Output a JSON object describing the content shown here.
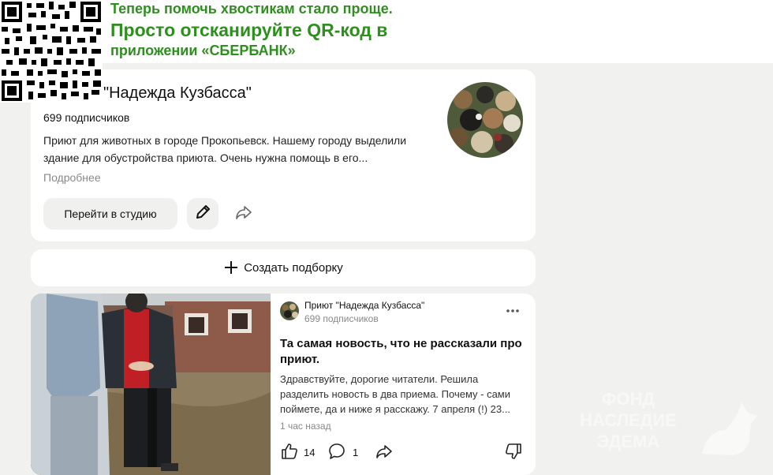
{
  "promo": {
    "line1": "Теперь помочь хвостикам стало проще.",
    "line2": "Просто отсканируйте QR-код в",
    "line3": "приложении «СБЕРБАНК»",
    "color": "#2e8f1f"
  },
  "profile": {
    "name": "\"Надежда Кузбасса\"",
    "subscribers": "699 подписчиков",
    "description": "Приют для животных в городе Прокопьевск. Нашему городу выделили здание для обустройства приюта. Очень нужна помощь в его...",
    "more_label": "Подробнее",
    "studio_button": "Перейти в студию",
    "icons": [
      "pencil-icon",
      "share-icon"
    ]
  },
  "collection": {
    "label": "Создать подборку",
    "icon": "plus-icon"
  },
  "post": {
    "channel": "Приют \"Надежда Кузбасса\"",
    "subscribers": "699 подписчиков",
    "menu_icon": "more-dots-icon",
    "title": "Та самая новость, что не рассказали про приют.",
    "text": "Здравствуйте, дорогие читатели. Решила разделить новость в два приема. Почему - сами поймете, да и ниже я расскажу. 7 апреля (!) 23...",
    "time": "1 час назад",
    "likes": "14",
    "comments": "1",
    "icons": [
      "like-icon",
      "comment-icon",
      "share-icon",
      "dislike-icon"
    ]
  },
  "watermark": {
    "line1": "ФОНД",
    "line2": "НАСЛЕДИЕ",
    "line3": "ЭДЕМА"
  }
}
